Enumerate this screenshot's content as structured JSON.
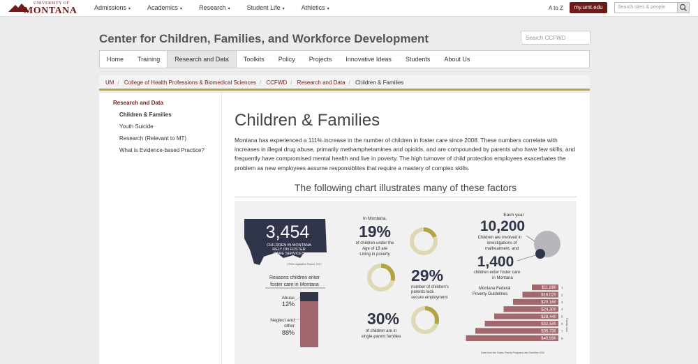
{
  "topbar": {
    "logo_top": "UNIVERSITY OF",
    "logo_name": "MONTANA",
    "nav": [
      {
        "label": "Admissions"
      },
      {
        "label": "Academics"
      },
      {
        "label": "Research"
      },
      {
        "label": "Student Life"
      },
      {
        "label": "Athletics"
      }
    ],
    "caret": "▾",
    "atoz": "A to Z",
    "myumt": "my.umt.edu",
    "search_placeholder": "Search sites & people"
  },
  "header": {
    "title": "Center for Children, Families, and Workforce Development",
    "search_placeholder": "Search CCFWD"
  },
  "mainnav": {
    "items": [
      {
        "label": "Home"
      },
      {
        "label": "Training"
      },
      {
        "label": "Research and Data"
      },
      {
        "label": "Toolkits"
      },
      {
        "label": "Policy"
      },
      {
        "label": "Projects"
      },
      {
        "label": "Innovative Ideas"
      },
      {
        "label": "Students"
      },
      {
        "label": "About Us"
      }
    ]
  },
  "breadcrumb": {
    "items": [
      {
        "label": "UM"
      },
      {
        "label": "College of Health Professions & Biomedical Sciences"
      },
      {
        "label": "CCFWD"
      },
      {
        "label": "Research and Data"
      },
      {
        "label": "Children & Families"
      }
    ],
    "sep": "/"
  },
  "sidenav": {
    "heading": "Research and Data",
    "items": [
      {
        "label": "Children & Families"
      },
      {
        "label": "Youth Suicide"
      },
      {
        "label": "Research (Relevant to MT)"
      },
      {
        "label": "What is Evidence-based Practice?"
      }
    ]
  },
  "main": {
    "title": "Children & Families",
    "intro": "Montana has experienced a 111% increase in the number of children in foster care since 2008. These numbers correlate with increases in illegal drug abuse, primarily methamphetamines and opioids, and are compounded by parents who have few skills, and frequently have compromised mental health and live in poverty. The high turnover of child protection employees exacerbates the problem as new employees assume responsiblites that require a mastery of complex skills.",
    "chart_heading": "The following chart illustrates many of these factors"
  },
  "infographic": {
    "big_number": "3,454",
    "big_caption1": "CHILDREN IN MONTANA",
    "big_caption2": "RELY ON FOSTER",
    "big_caption3": "CARE SERVICES",
    "big_source": "CFSD Legislative Report, 2017",
    "reasons_title1": "Reasons children enter",
    "reasons_title2": "foster care in Montana",
    "abuse_label": "Abuse",
    "abuse_pct": "12%",
    "neglect_label1": "Neglect and",
    "neglect_label2": "other",
    "neglect_pct": "88%",
    "stat1_pre": "In Montana,",
    "stat1_num": "19%",
    "stat1_cap1": "of children under the",
    "stat1_cap2": "Age of 18 are",
    "stat1_cap3": "Living in poverty",
    "stat2_num": "29%",
    "stat2_cap1": "number of children's",
    "stat2_cap2": "parents lack",
    "stat2_cap3": "secure employment",
    "stat3_num": "30%",
    "stat3_cap1": "of children are in",
    "stat3_cap2": "single-parent families",
    "each_year": "Each year",
    "inv_num": "10,200",
    "inv_cap1": "Children are involved in",
    "inv_cap2": "investigations of",
    "inv_cap3": "maltreatment, and",
    "fc_num": "1,400",
    "fc_cap1": "children enter foster care",
    "fc_cap2": "in Montana",
    "poverty_title1": "Montana Federal",
    "poverty_title2": "Poverty  Guidelines",
    "family_size": "Family size",
    "poverty": [
      {
        "amount": "$11,880",
        "size": "1"
      },
      {
        "amount": "$16,020",
        "size": "2"
      },
      {
        "amount": "$20,160",
        "size": "3"
      },
      {
        "amount": "$24,300",
        "size": "4"
      },
      {
        "amount": "$28,440",
        "size": "5"
      },
      {
        "amount": "$32,580",
        "size": "6"
      },
      {
        "amount": "$36,730",
        "size": "7"
      },
      {
        "amount": "$40,890",
        "size": "8"
      }
    ],
    "source": "Data from the Casey Family Programs and Families USA",
    "colors": {
      "navy": "#2f3448",
      "mauve": "#a2676c",
      "olive": "#b1a443",
      "cream": "#ded9b4",
      "grey": "#b8b6ba"
    },
    "pct_values": {
      "poverty": 0.19,
      "unemployment": 0.29,
      "single_parent": 0.3,
      "abuse": 0.12
    }
  }
}
